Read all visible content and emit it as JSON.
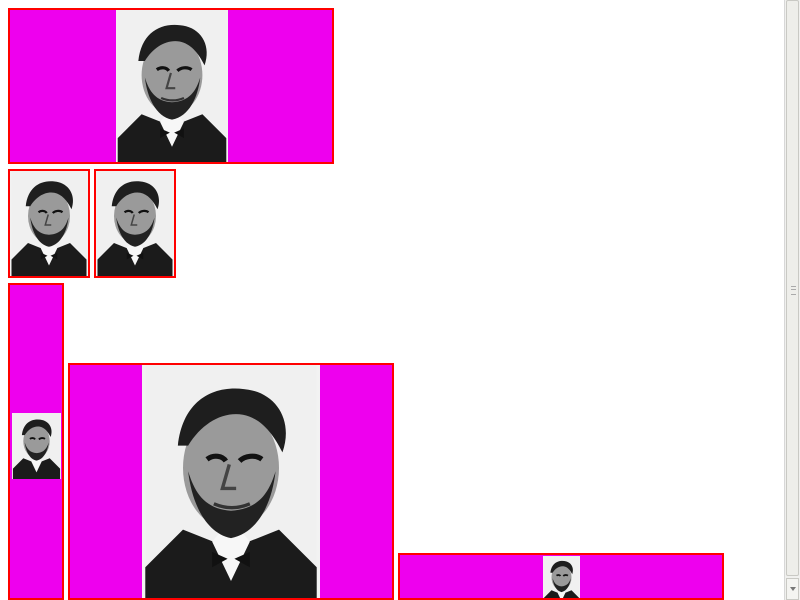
{
  "page": {
    "background_color": "#ffffff"
  },
  "image_boxes": [
    {
      "name": "image-box-wide-top",
      "portrait_icon": "lincoln-portrait-icon",
      "border_color": "#ff0000",
      "fill_color": "#ee00ee"
    },
    {
      "name": "image-box-small-left",
      "portrait_icon": "lincoln-portrait-icon",
      "border_color": "#ff0000",
      "fill_color": "#ee00ee"
    },
    {
      "name": "image-box-small-right",
      "portrait_icon": "lincoln-portrait-icon",
      "border_color": "#ff0000",
      "fill_color": "#ee00ee"
    },
    {
      "name": "image-box-tall-left",
      "portrait_icon": "lincoln-portrait-icon",
      "border_color": "#ff0000",
      "fill_color": "#ee00ee"
    },
    {
      "name": "image-box-large-center",
      "portrait_icon": "lincoln-portrait-icon",
      "border_color": "#ff0000",
      "fill_color": "#ee00ee"
    },
    {
      "name": "image-box-wide-bottom",
      "portrait_icon": "lincoln-portrait-icon",
      "border_color": "#ff0000",
      "fill_color": "#ee00ee"
    }
  ],
  "scrollbar": {
    "icon": "vertical-scrollbar",
    "thumb_icon": "scroll-thumb-grip-icon",
    "down_icon": "scroll-down-arrow-icon"
  }
}
